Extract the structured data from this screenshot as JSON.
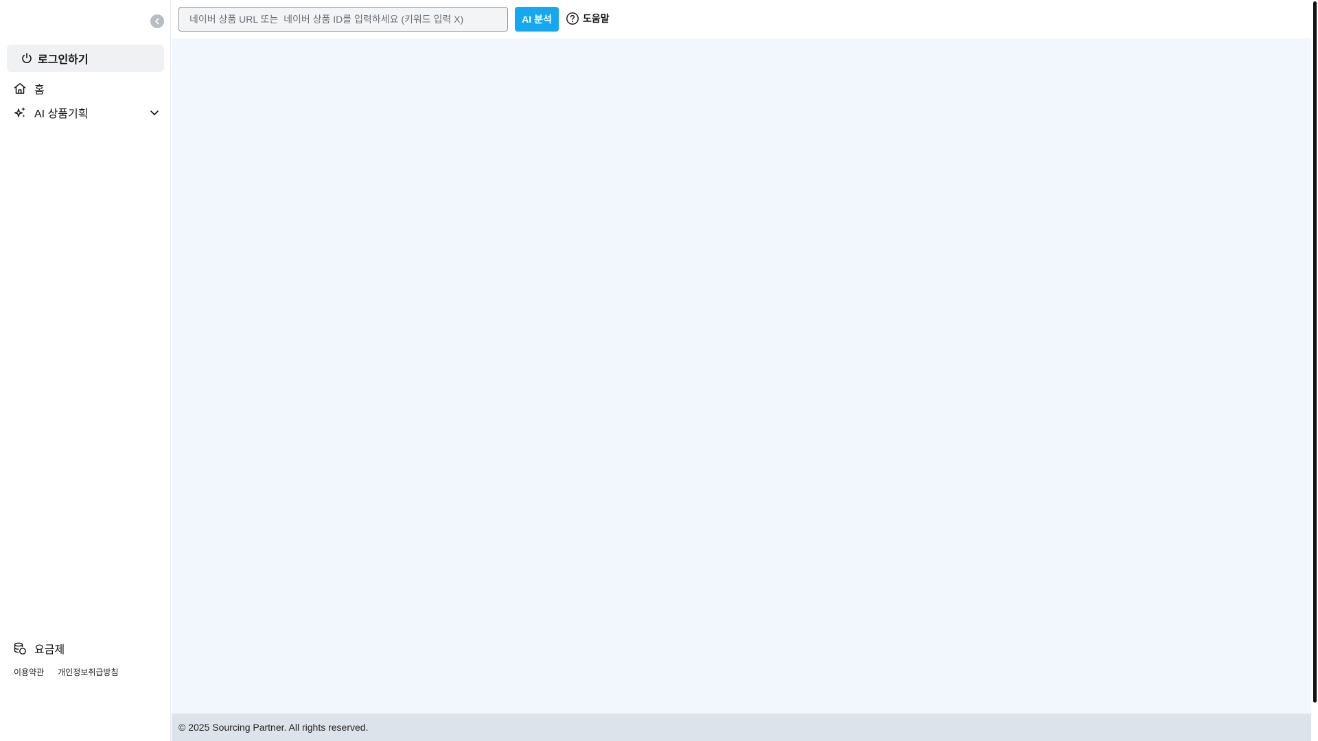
{
  "sidebar": {
    "collapse_icon": "chevron-left-icon",
    "login": {
      "label": "로그인하기",
      "icon": "power-icon"
    },
    "nav": {
      "home": {
        "label": "홈",
        "icon": "home-icon"
      },
      "ai_planning": {
        "label": "AI 상품기획",
        "icon": "sparkles-icon",
        "expand_icon": "chevron-down-icon"
      },
      "pricing": {
        "label": "요금제",
        "icon": "coins-icon"
      }
    },
    "footer_links": {
      "terms": "이용약관",
      "privacy": "개인정보취급방침"
    }
  },
  "topbar": {
    "search": {
      "value": "",
      "placeholder": "네이버 상품 URL 또는  네이버 상품 ID를 입력하세요 (키워드 입력 X)"
    },
    "analyze_label": "AI 분석",
    "help": {
      "label": "도움말",
      "icon": "help-circle-icon"
    }
  },
  "footer": {
    "copyright": "© 2025 Sourcing Partner. All rights reserved."
  },
  "colors": {
    "accent": "#14a8f0",
    "main_bg": "#f2f7fe",
    "footer_bg": "#dde3ea",
    "login_bg": "#f0f1f3"
  }
}
